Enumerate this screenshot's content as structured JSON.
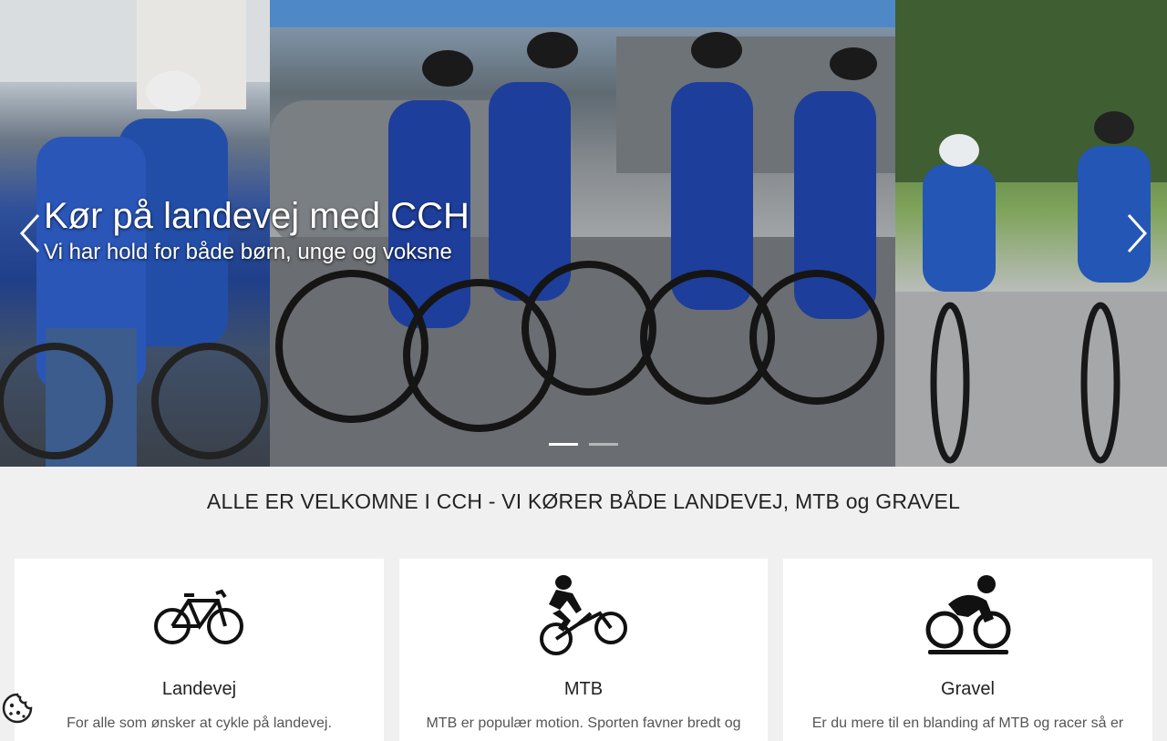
{
  "hero": {
    "slides": [
      {
        "title": "Kør på landevej med CCH",
        "subtitle": "Vi har hold for både børn, unge og voksne"
      }
    ],
    "prev_icon": "chevron-left-icon",
    "next_icon": "chevron-right-icon",
    "indicator_count": 2,
    "active_indicator": 1
  },
  "headline": "ALLE ER VELKOMNE I CCH - VI KØRER BÅDE LANDEVEJ, MTB og GRAVEL",
  "cards": [
    {
      "icon": "road-bike-icon",
      "title": "Landevej",
      "text": "For alle som ønsker at cykle på landevej."
    },
    {
      "icon": "mountain-bike-rider-icon",
      "title": "MTB",
      "text": "MTB er populær motion. Sporten favner bredt og"
    },
    {
      "icon": "cyclist-icon",
      "title": "Gravel",
      "text": "Er du mere til en blanding af MTB og racer så er"
    }
  ],
  "cookie_icon": "cookie-icon",
  "colors": {
    "background": "#f0f0f0",
    "card": "#ffffff",
    "text": "#222222"
  }
}
